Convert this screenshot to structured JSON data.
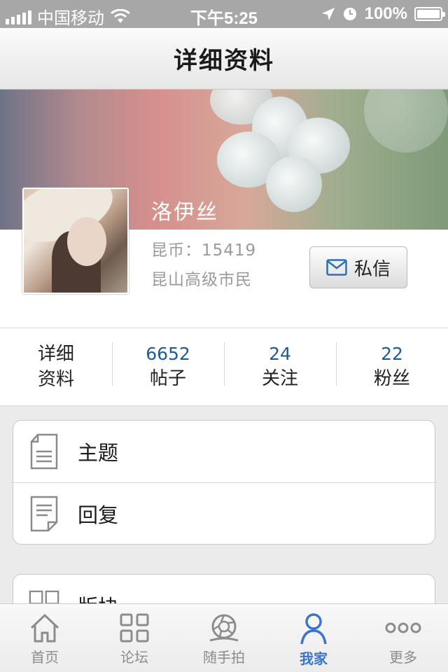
{
  "status_bar": {
    "carrier": "中国移动",
    "time": "下午5:25",
    "battery": "100%",
    "battery_level": 1.0
  },
  "nav": {
    "title": "详细资料"
  },
  "profile": {
    "name": "洛伊丝",
    "coins": "昆币：15419",
    "rank": "昆山高级市民",
    "message_button": "私信"
  },
  "stats": [
    {
      "number": "",
      "label_line1": "详细",
      "label_line2": "资料"
    },
    {
      "number": "6652",
      "label": "帖子"
    },
    {
      "number": "24",
      "label": "关注"
    },
    {
      "number": "22",
      "label": "粉丝"
    }
  ],
  "list1": [
    {
      "label": "主题",
      "icon": "document-icon"
    },
    {
      "label": "回复",
      "icon": "reply-document-icon"
    }
  ],
  "list2": [
    {
      "label": "版块",
      "icon": "grid-icon"
    }
  ],
  "tabbar": [
    {
      "label": "首页",
      "icon": "home-icon",
      "active": false
    },
    {
      "label": "论坛",
      "icon": "forum-grid-icon",
      "active": false
    },
    {
      "label": "随手拍",
      "icon": "camera-aperture-icon",
      "active": false
    },
    {
      "label": "我家",
      "icon": "person-icon",
      "active": true
    },
    {
      "label": "更多",
      "icon": "more-dots-icon",
      "active": false
    }
  ],
  "colors": {
    "accent_blue": "#1e5c93",
    "active_tab": "#3b74c9"
  }
}
